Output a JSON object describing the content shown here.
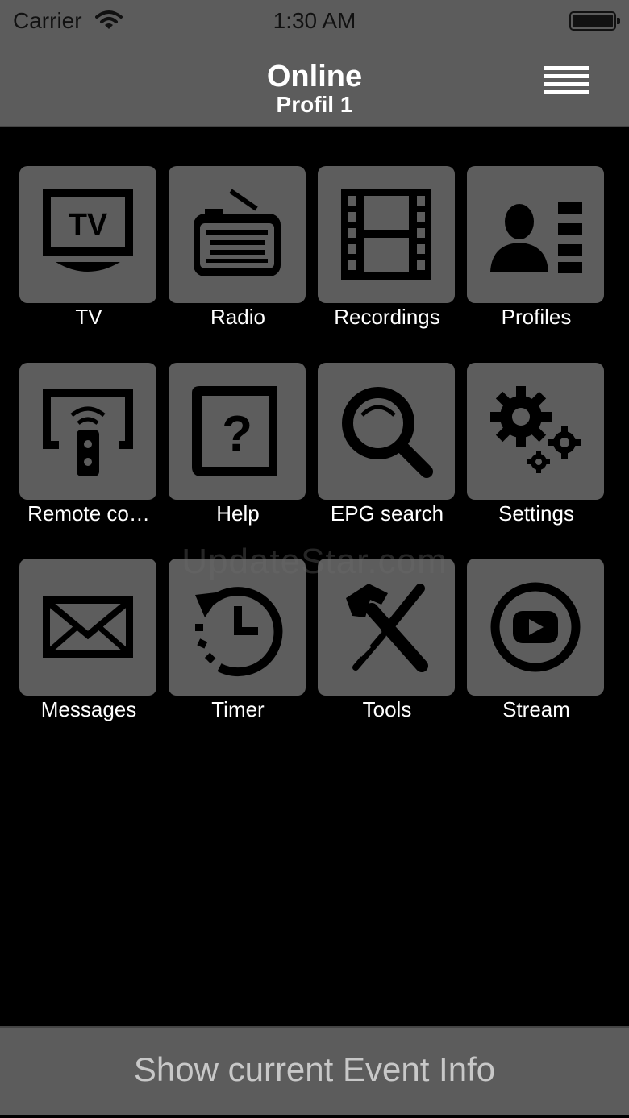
{
  "status_bar": {
    "carrier": "Carrier",
    "time": "1:30 AM"
  },
  "nav": {
    "title": "Online",
    "subtitle": "Profil 1",
    "menu_icon": "hamburger-icon"
  },
  "tiles": [
    {
      "label": "TV",
      "icon": "tv-icon"
    },
    {
      "label": "Radio",
      "icon": "radio-icon"
    },
    {
      "label": "Recordings",
      "icon": "film-icon"
    },
    {
      "label": "Profiles",
      "icon": "profile-card-icon"
    },
    {
      "label": "Remote co…",
      "icon": "remote-control-icon"
    },
    {
      "label": "Help",
      "icon": "help-book-icon"
    },
    {
      "label": "EPG search",
      "icon": "magnifier-icon"
    },
    {
      "label": "Settings",
      "icon": "gears-icon"
    },
    {
      "label": "Messages",
      "icon": "envelope-icon"
    },
    {
      "label": "Timer",
      "icon": "clock-history-icon"
    },
    {
      "label": "Tools",
      "icon": "hammer-screwdriver-icon"
    },
    {
      "label": "Stream",
      "icon": "play-stream-icon"
    }
  ],
  "watermark": "UpdateStar.com",
  "bottom_button": {
    "label": "Show current Event Info"
  },
  "colors": {
    "bar": "#5c5c5c",
    "tile": "#5d5d5d",
    "background": "#000000",
    "icon": "#000000",
    "text": "#ffffff"
  }
}
